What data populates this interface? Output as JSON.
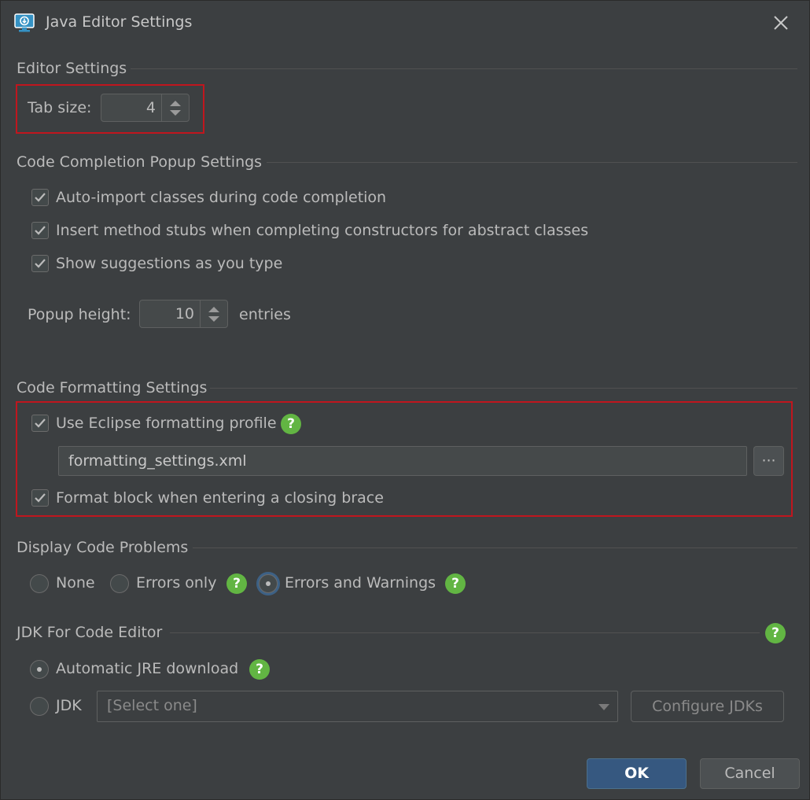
{
  "window": {
    "title": "Java Editor Settings"
  },
  "editor_settings": {
    "section": "Editor Settings",
    "tab_size_label": "Tab size:",
    "tab_size_value": "4"
  },
  "completion": {
    "section": "Code Completion Popup Settings",
    "options": [
      {
        "label": "Auto-import classes during code completion",
        "checked": true
      },
      {
        "label": "Insert method stubs when completing constructors for abstract classes",
        "checked": true
      },
      {
        "label": "Show suggestions as you type",
        "checked": true
      }
    ],
    "popup_height_label": "Popup height:",
    "popup_height_value": "10",
    "popup_height_unit": "entries"
  },
  "formatting": {
    "section": "Code Formatting Settings",
    "use_eclipse_label": "Use Eclipse formatting profile",
    "file_value": "formatting_settings.xml",
    "browse_label": "···",
    "format_block_label": "Format block when entering a closing brace"
  },
  "problems": {
    "section": "Display Code Problems",
    "none_label": "None",
    "errors_only_label": "Errors only",
    "errors_warnings_label": "Errors and Warnings",
    "selected": "Errors and Warnings"
  },
  "jdk": {
    "section": "JDK For Code Editor",
    "auto_label": "Automatic JRE download",
    "jdk_label": "JDK",
    "select_value": "[Select one]",
    "configure_label": "Configure JDKs",
    "selected": "Automatic JRE download"
  },
  "footer": {
    "ok_label": "OK",
    "cancel_label": "Cancel"
  },
  "colors": {
    "background": "#3c3f41",
    "accent": "#365880",
    "help_green": "#62b543",
    "highlight_red": "#c0161e"
  }
}
